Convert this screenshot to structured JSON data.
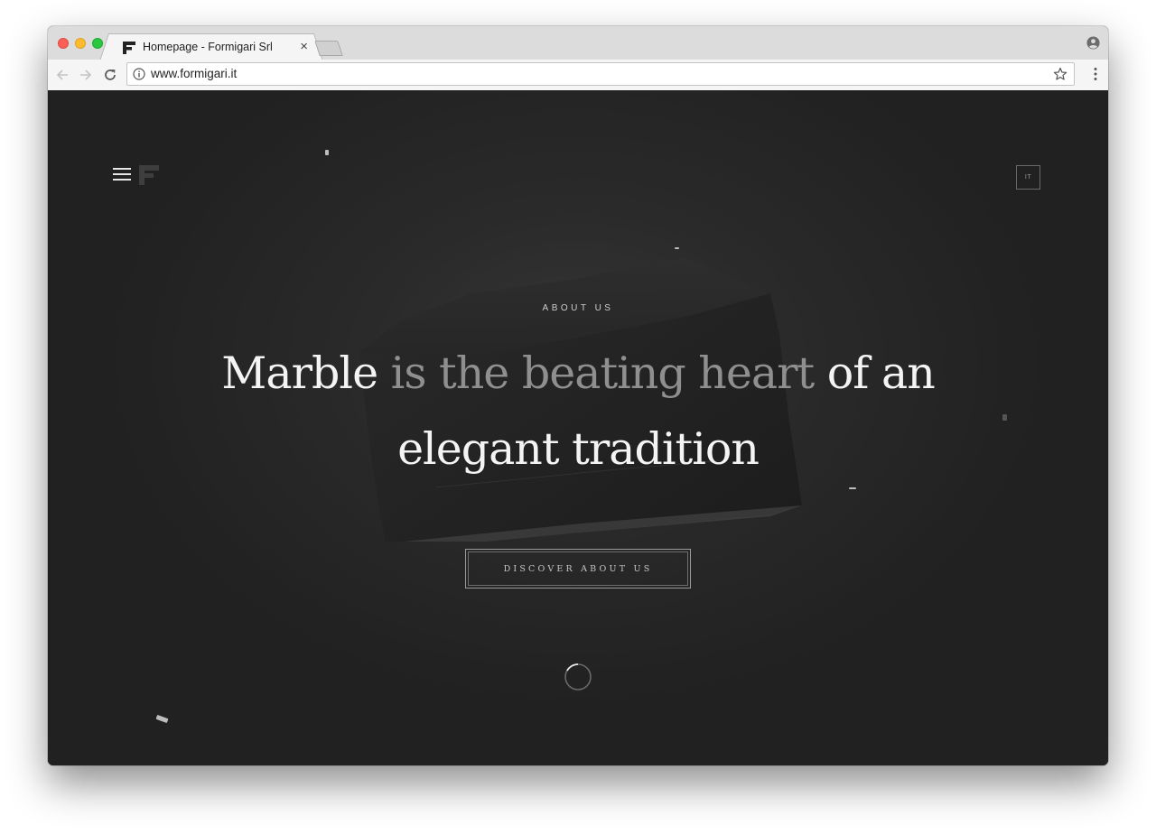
{
  "browser": {
    "tab": {
      "title": "Homepage - Formigari Srl",
      "close_glyph": "×",
      "favicon": "formigari-f-logo-icon"
    },
    "address_bar": {
      "url": "www.formigari.it",
      "info_icon": "info-icon",
      "bookmark_icon": "star-icon"
    },
    "nav": {
      "back_icon": "back-arrow-icon",
      "forward_icon": "forward-arrow-icon",
      "reload_icon": "reload-icon"
    },
    "profile_icon": "profile-icon",
    "menu_icon": "kebab-menu-icon"
  },
  "header": {
    "menu_icon": "hamburger-icon",
    "logo_icon": "formigari-f-logo-icon",
    "language": "IT"
  },
  "hero": {
    "eyebrow": "ABOUT US",
    "headline": {
      "part1": "Marble",
      "part2_muted": " is the beating heart ",
      "part3": "of an elegant tradition"
    },
    "cta_label": "DISCOVER ABOUT US",
    "loader_icon": "loading-spinner-icon"
  },
  "colors": {
    "page_background": "#232323",
    "headline_primary": "#f4f4f4",
    "headline_muted": "#8f8f8f",
    "tab_bar": "#dcdcdc"
  }
}
